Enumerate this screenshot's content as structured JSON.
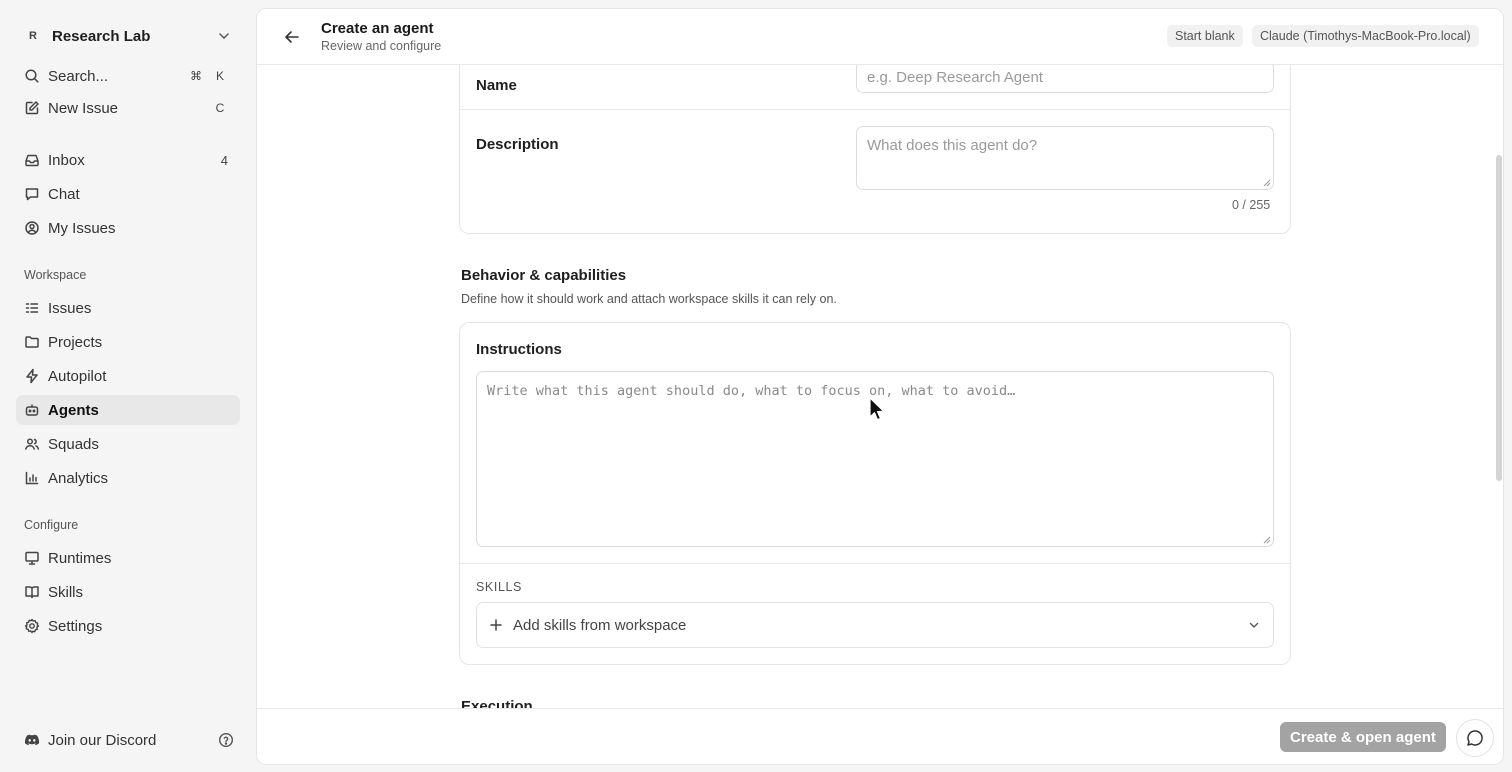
{
  "workspace": {
    "avatar": "R",
    "name": "Research Lab"
  },
  "sidebar": {
    "search": {
      "label": "Search...",
      "kbd1": "⌘",
      "kbd2": "K"
    },
    "new_issue": {
      "label": "New Issue",
      "kbd": "C"
    },
    "inbox": {
      "label": "Inbox",
      "count": "4"
    },
    "chat": {
      "label": "Chat"
    },
    "my_issues": {
      "label": "My Issues"
    },
    "workspace_section": "Workspace",
    "workspace_items": [
      {
        "label": "Issues",
        "icon": "issues-icon"
      },
      {
        "label": "Projects",
        "icon": "folder-icon"
      },
      {
        "label": "Autopilot",
        "icon": "lightning-icon"
      },
      {
        "label": "Agents",
        "icon": "bot-icon",
        "active": true
      },
      {
        "label": "Squads",
        "icon": "users-icon"
      },
      {
        "label": "Analytics",
        "icon": "bar-chart-icon"
      }
    ],
    "configure_section": "Configure",
    "configure_items": [
      {
        "label": "Runtimes",
        "icon": "monitor-icon"
      },
      {
        "label": "Skills",
        "icon": "book-icon"
      },
      {
        "label": "Settings",
        "icon": "gear-icon"
      }
    ],
    "discord": "Join our Discord"
  },
  "header": {
    "title": "Create an agent",
    "subtitle": "Review and configure",
    "start_blank": "Start blank",
    "runtime": "Claude (Timothys-MacBook-Pro.local)"
  },
  "form": {
    "name_label": "Name",
    "name_placeholder": "e.g. Deep Research Agent",
    "description_label": "Description",
    "description_placeholder": "What does this agent do?",
    "description_counter": "0 / 255",
    "behavior_title": "Behavior & capabilities",
    "behavior_desc": "Define how it should work and attach workspace skills it can rely on.",
    "instructions_label": "Instructions",
    "instructions_placeholder": "Write what this agent should do, what to focus on, what to avoid…",
    "skills_label": "SKILLS",
    "skills_add": "Add skills from workspace",
    "execution_title": "Execution"
  },
  "footer": {
    "create_button": "Create & open agent"
  },
  "colors": {
    "active_bg": "#e8e8e8",
    "button_disabled": "#a3a3a3"
  }
}
